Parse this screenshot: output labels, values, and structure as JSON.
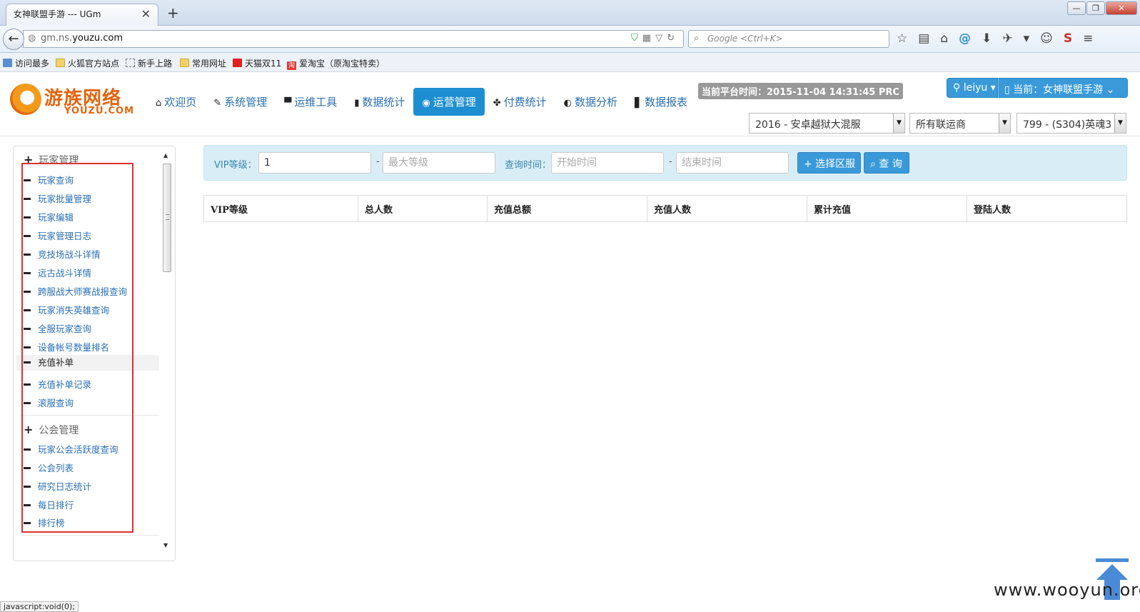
{
  "browser": {
    "tab_title": "女神联盟手游 --- UGm",
    "tab_close": "✕",
    "new_tab": "+",
    "url_prefix": "gm.ns.",
    "url_host": "youzu.com",
    "search_placeholder": "Google <Ctrl+K>",
    "window_controls": {
      "minimize": "—",
      "restore": "❐",
      "close": "✕"
    }
  },
  "bookmarks": [
    {
      "label": "访问最多",
      "icon": "bookmark-icon"
    },
    {
      "label": "火狐官方站点",
      "icon": "folder-icon"
    },
    {
      "label": "新手上路",
      "icon": "page-icon"
    },
    {
      "label": "常用网址",
      "icon": "folder-icon"
    },
    {
      "label": "天猫双11",
      "icon": "tmall-icon"
    },
    {
      "label": "爱淘宝（原淘宝特卖）",
      "icon": "taobao-icon"
    }
  ],
  "taobao_glyph": "淘",
  "logo": {
    "cn": "游族网络",
    "en": "YOUZU.COM"
  },
  "nav": [
    {
      "label": "欢迎页",
      "icon": "home-icon",
      "glyph": "⌂"
    },
    {
      "label": "系统管理",
      "icon": "wrench-icon",
      "glyph": "✎"
    },
    {
      "label": "运维工具",
      "icon": "hdd-icon",
      "glyph": "▀"
    },
    {
      "label": "数据统计",
      "icon": "signal-icon",
      "glyph": "▮"
    },
    {
      "label": "运营管理",
      "icon": "globe-icon",
      "glyph": "◉",
      "active": true
    },
    {
      "label": "付费统计",
      "icon": "gift-icon",
      "glyph": "✤"
    },
    {
      "label": "数据分析",
      "icon": "adjust-icon",
      "glyph": "◐"
    },
    {
      "label": "数据报表",
      "icon": "book-icon",
      "glyph": "▋"
    }
  ],
  "server_time": "当前平台时间：2015-11-04 14:31:45 PRC",
  "user": {
    "name": "leiyu",
    "current_label": "当前：女神联盟手游"
  },
  "selects": {
    "server": "2016 - 安卓越狱大混服",
    "operator": "所有联运商",
    "zone": "799 - (S304)英魂3"
  },
  "sidebar": {
    "groups": [
      {
        "title": "玩家管理",
        "items": [
          "玩家查询",
          "玩家批量管理",
          "玩家编辑",
          "玩家管理日志",
          "竞技场战斗详情",
          "远古战斗详情",
          "跨服战大师赛战报查询",
          "玩家消失英雄查询",
          "全服玩家查询",
          "设备帐号数量排名",
          "充值补单",
          "充值补单记录",
          "滚服查询"
        ]
      },
      {
        "title": "公会管理",
        "items": [
          "玩家公会活跃度查询",
          "公会列表",
          "研究日志统计",
          "每日排行",
          "排行榜"
        ]
      }
    ]
  },
  "filter": {
    "vip_label": "VIP等级：",
    "vip_min_value": "1",
    "vip_max_placeholder": "最大等级",
    "time_label": "查询时间：",
    "start_placeholder": "开始时间",
    "end_placeholder": "结束时间",
    "range_dash": "-",
    "select_zone_btn": "+ 选择区服",
    "query_btn": "查 询"
  },
  "table": {
    "columns": [
      "VIP等级",
      "总人数",
      "充值总额",
      "充值人数",
      "累计充值",
      "登陆人数"
    ]
  },
  "status_text": "javascript:void(0);",
  "watermark": "www.wooyun.org"
}
